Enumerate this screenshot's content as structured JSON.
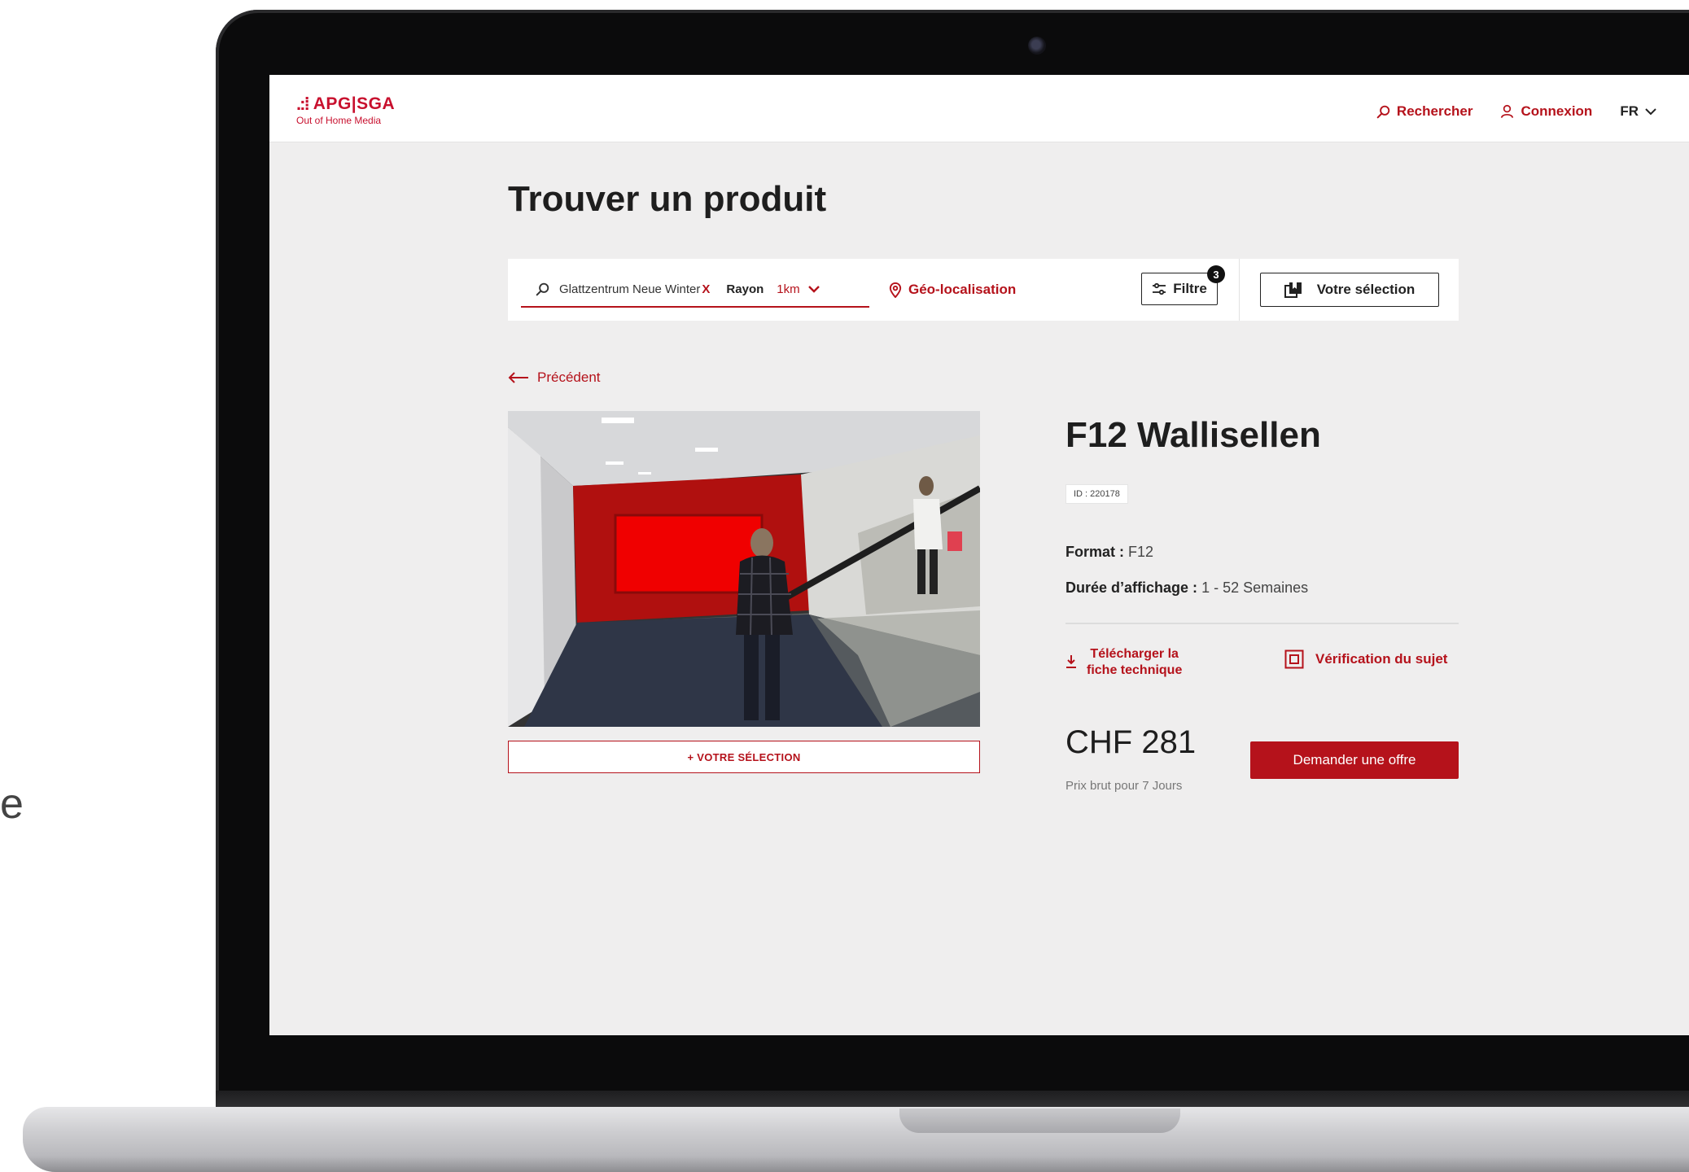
{
  "edge_text": "e",
  "header": {
    "logo_brand": "APG|SGA",
    "logo_tagline": "Out of Home Media",
    "nav": {
      "search_label": "Rechercher",
      "login_label": "Connexion",
      "language": "FR"
    }
  },
  "page": {
    "title": "Trouver un produit"
  },
  "search": {
    "query": "Glattzentrum Neue Winter",
    "clear_label": "X",
    "radius_label": "Rayon",
    "radius_value": "1km",
    "geo_label": "Géo-localisation",
    "filter_label": "Filtre",
    "filter_count": "3",
    "selection_label": "Votre sélection"
  },
  "nav_back": "Précédent",
  "product": {
    "title": "F12 Wallisellen",
    "id": "ID : 220178",
    "format_label": "Format :",
    "format_value": "F12",
    "duration_label": "Durée d’affichage :",
    "duration_value": "1 - 52 Semaines",
    "download_line1": "Télécharger la",
    "download_line2": "fiche technique",
    "verify_label": "Vérification du sujet",
    "price": "CHF 281",
    "price_note": "Prix brut pour 7 Jours",
    "offer_button": "Demander une offre",
    "add_selection_button": "+ VOTRE SÉLECTION"
  },
  "icons": {
    "search": "search-icon",
    "user": "user-icon",
    "chevron": "chevron-down-icon",
    "location": "location-pin-icon",
    "filter": "filter-sliders-icon",
    "selection": "bookmark-stack-icon",
    "back": "arrow-left-icon",
    "download": "download-icon",
    "verify": "frame-check-icon"
  },
  "colors": {
    "brand_red": "#b5121b",
    "background": "#efeeee"
  }
}
